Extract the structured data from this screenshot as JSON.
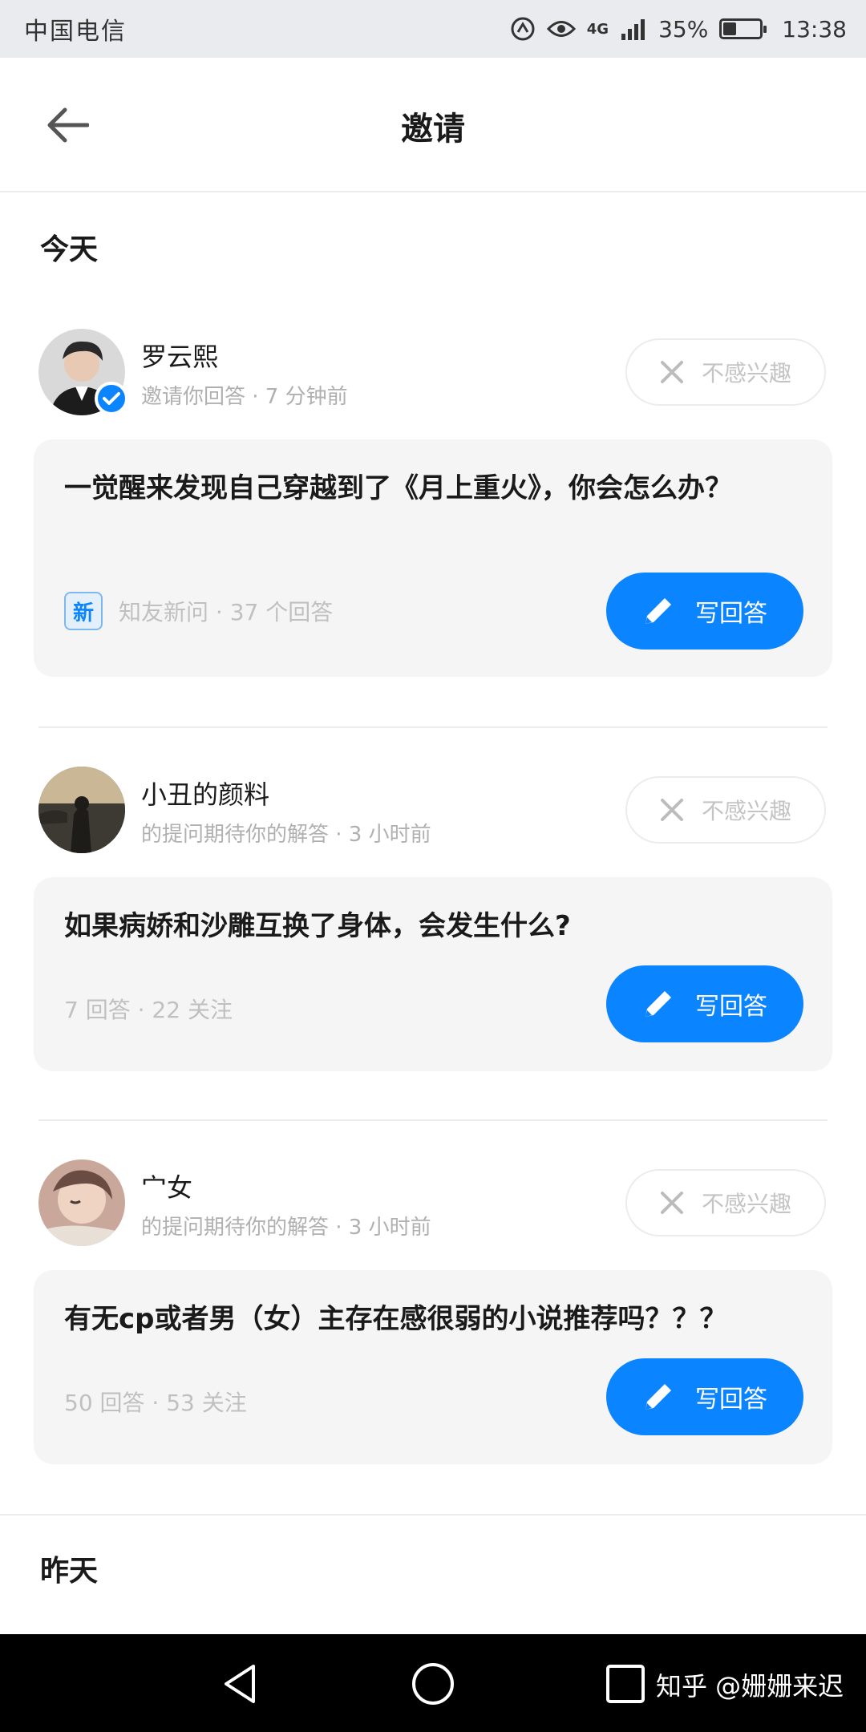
{
  "status_bar": {
    "carrier": "中国电信",
    "network": "4G",
    "battery": "35%",
    "battery_level": 0.35,
    "time": "13:38"
  },
  "header": {
    "title": "邀请"
  },
  "sections": {
    "today": "今天",
    "yesterday": "昨天"
  },
  "invites": [
    {
      "inviter": "罗云熙",
      "meta": "邀请你回答 · 7 分钟前",
      "verified": true,
      "not_interested_label": "不感兴趣",
      "question": "一觉醒来发现自己穿越到了《月上重火》，你会怎么办？",
      "new_badge": "新",
      "question_meta": "知友新问 · 37 个回答",
      "answer_label": "写回答"
    },
    {
      "inviter": "小丑的颜料",
      "meta": "的提问期待你的解答 · 3 小时前",
      "verified": false,
      "not_interested_label": "不感兴趣",
      "question": "如果病娇和沙雕互换了身体，会发生什么?",
      "question_meta": "7 回答 · 22 关注",
      "answer_label": "写回答"
    },
    {
      "inviter": "宀女",
      "meta": "的提问期待你的解答 · 3 小时前",
      "verified": false,
      "not_interested_label": "不感兴趣",
      "question": "有无cp或者男（女）主存在感很弱的小说推荐吗？？？",
      "question_meta": "50 回答 · 53 关注",
      "answer_label": "写回答"
    }
  ],
  "watermark": "知乎 @姗姗来迟",
  "colors": {
    "accent": "#0a84ff",
    "card_bg": "#f5f5f6",
    "muted_text": "#b0b0b0"
  },
  "icons": [
    "back-arrow-icon",
    "close-icon",
    "pencil-icon",
    "verified-check-icon",
    "nav-back-icon",
    "nav-home-icon",
    "nav-recents-icon"
  ]
}
